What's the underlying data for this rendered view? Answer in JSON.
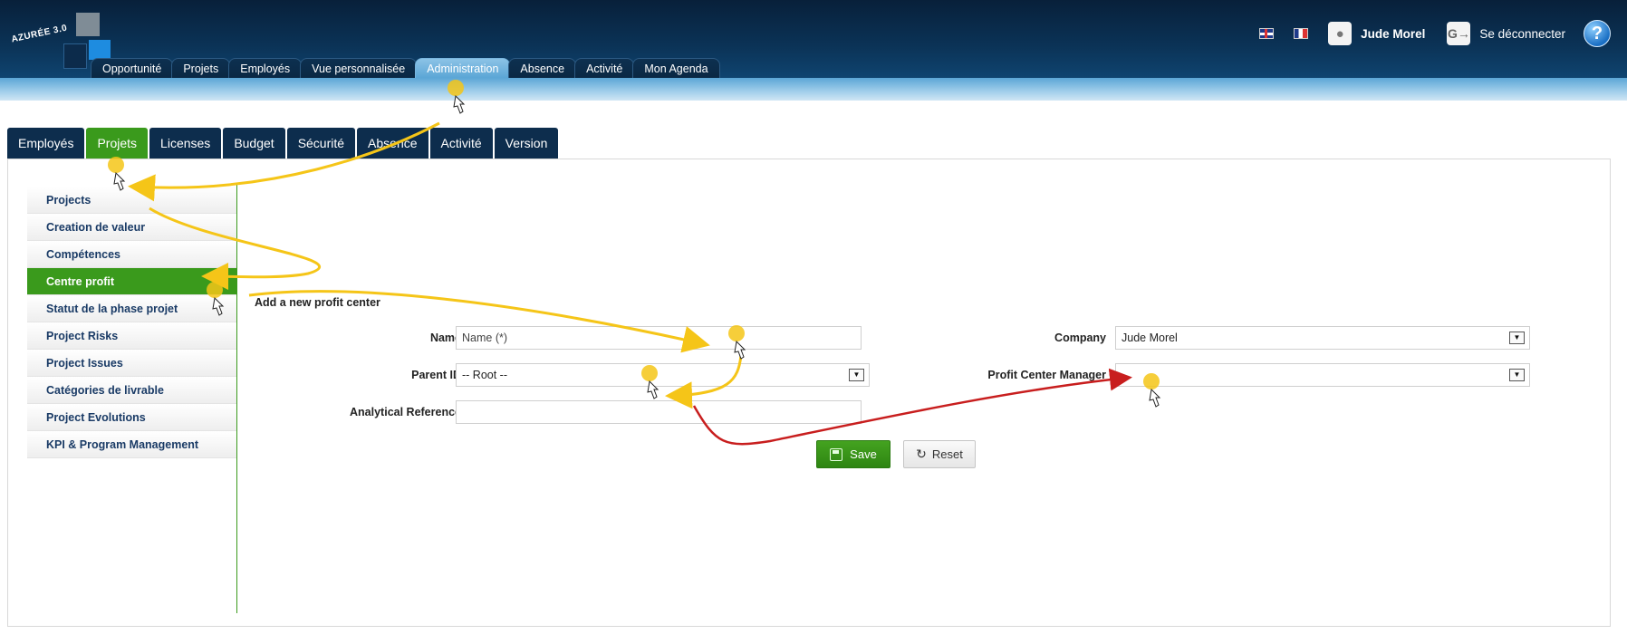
{
  "app": {
    "logo_text": "AZURÉE 3.0"
  },
  "header": {
    "user_name": "Jude Morel",
    "logout_label": "Se déconnecter",
    "help_symbol": "?"
  },
  "main_nav": {
    "tabs": [
      {
        "label": "Opportunité"
      },
      {
        "label": "Projets"
      },
      {
        "label": "Employés"
      },
      {
        "label": "Vue personnalisée"
      },
      {
        "label": "Administration",
        "active": true
      },
      {
        "label": "Absence"
      },
      {
        "label": "Activité"
      },
      {
        "label": "Mon Agenda"
      }
    ]
  },
  "sub_tabs": [
    {
      "label": "Employés"
    },
    {
      "label": "Projets",
      "active": true
    },
    {
      "label": "Licenses"
    },
    {
      "label": "Budget"
    },
    {
      "label": "Sécurité"
    },
    {
      "label": "Absence"
    },
    {
      "label": "Activité"
    },
    {
      "label": "Version"
    }
  ],
  "sidebar": {
    "items": [
      {
        "label": "Projects"
      },
      {
        "label": "Creation de valeur"
      },
      {
        "label": "Compétences"
      },
      {
        "label": "Centre profit",
        "active": true
      },
      {
        "label": "Statut de la phase projet"
      },
      {
        "label": "Project Risks"
      },
      {
        "label": "Project Issues"
      },
      {
        "label": "Catégories de livrable"
      },
      {
        "label": "Project Evolutions"
      },
      {
        "label": "KPI & Program Management"
      }
    ]
  },
  "form": {
    "title": "Add a new profit center",
    "name_label": "Name",
    "name_placeholder": "Name (*)",
    "parent_label": "Parent ID",
    "parent_value": "-- Root --",
    "analytical_label": "Analytical Reference",
    "analytical_value": "",
    "company_label": "Company",
    "company_value": "Jude Morel",
    "manager_label": "Profit Center Manager",
    "manager_value": "",
    "save_label": "Save",
    "reset_label": "Reset"
  },
  "colors": {
    "header_dark": "#0b3357",
    "active_green": "#3a9a1c",
    "nav_link": "#1a3b66",
    "annotation_yellow": "#f5c518",
    "annotation_red": "#c81e1e"
  }
}
